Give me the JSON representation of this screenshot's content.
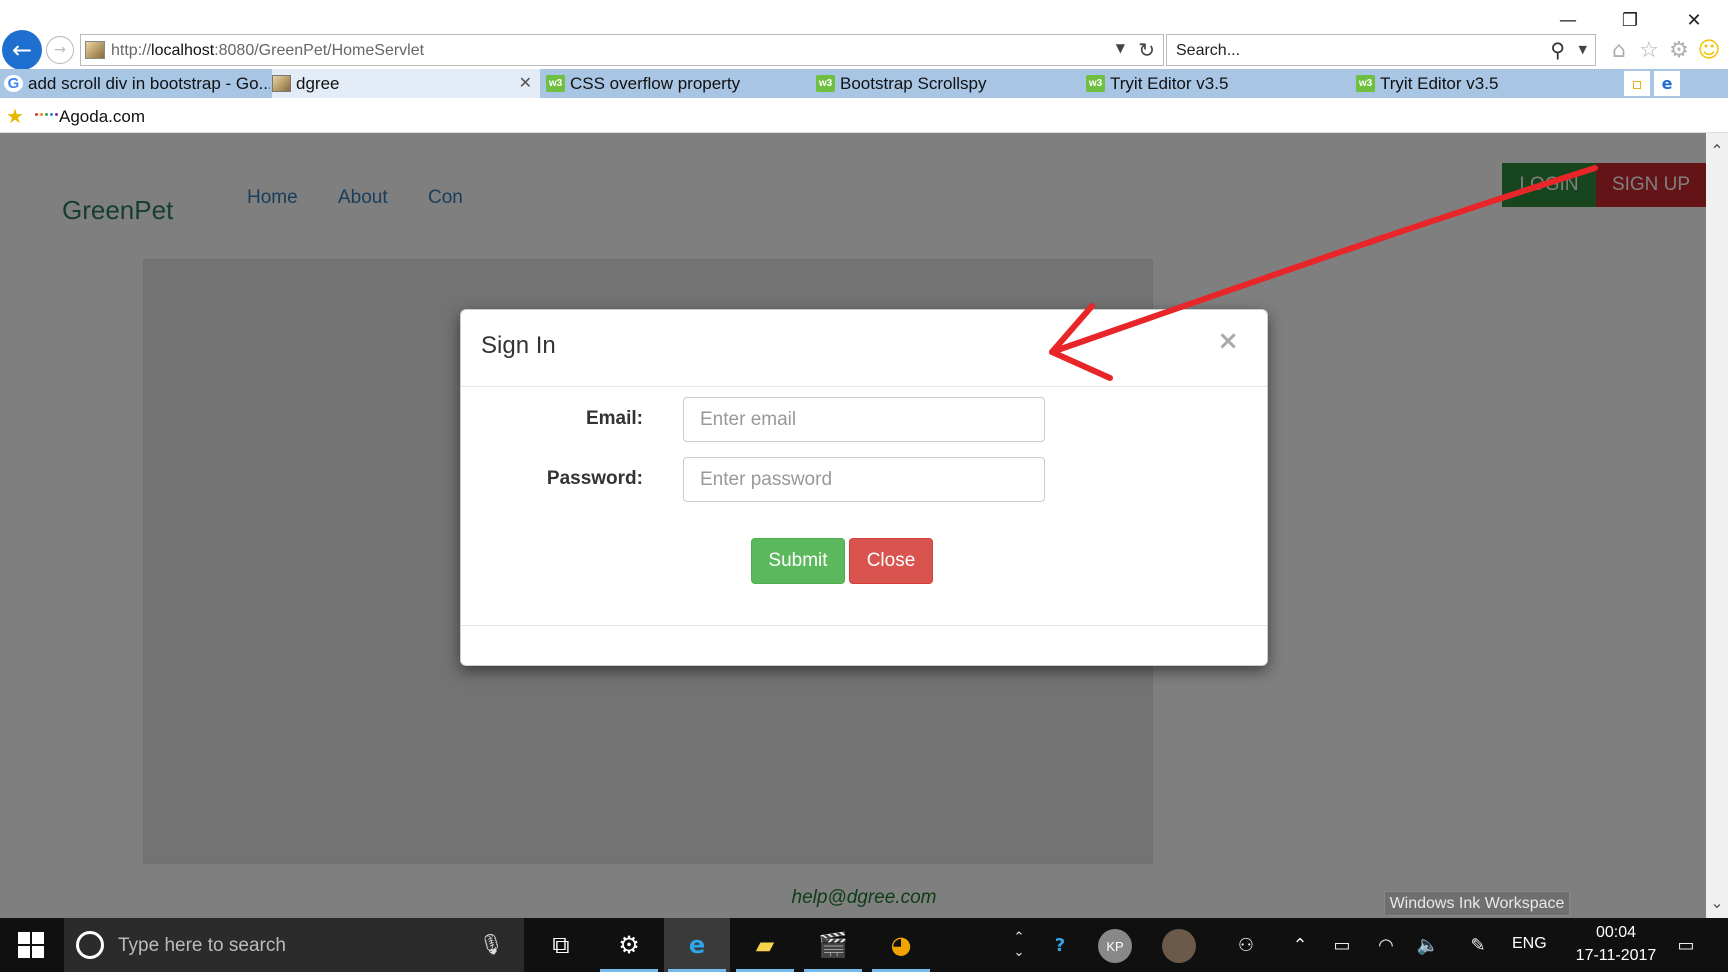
{
  "window": {
    "minimize_icon": "minimize-icon",
    "restore_icon": "restore-icon",
    "close_icon": "close-icon"
  },
  "address_bar": {
    "url_prefix": "http://",
    "url_host": "localhost",
    "url_rest": ":8080/GreenPet/HomeServlet"
  },
  "search_box": {
    "placeholder": "Search..."
  },
  "tabs": [
    {
      "label": "add scroll div in bootstrap - Go...",
      "icon": "google-icon"
    },
    {
      "label": "dgree",
      "icon": "page-icon",
      "active": true
    },
    {
      "label": "CSS overflow property",
      "icon": "w3schools-icon"
    },
    {
      "label": "Bootstrap Scrollspy",
      "icon": "w3schools-icon"
    },
    {
      "label": "Tryit Editor v3.5",
      "icon": "w3schools-icon"
    },
    {
      "label": "Tryit Editor v3.5",
      "icon": "w3schools-icon"
    }
  ],
  "favorites_bar": {
    "items": [
      {
        "label": "Agoda.com"
      }
    ]
  },
  "site": {
    "brand": "GreenPet",
    "nav": [
      "Home",
      "About",
      "Con"
    ],
    "login_label": "LOGIN",
    "signup_label": "SIGN UP",
    "footer_email": "help@dgree.com",
    "colors": {
      "login": "#2e8b3a",
      "signup": "#c8282d",
      "brand": "#2e7d5b"
    }
  },
  "modal": {
    "title": "Sign In",
    "close_glyph": "×",
    "email_label": "Email:",
    "email_placeholder": "Enter email",
    "password_label": "Password:",
    "password_placeholder": "Enter password",
    "submit_label": "Submit",
    "close_label": "Close"
  },
  "ink_tooltip": "Windows Ink Workspace",
  "taskbar": {
    "search_placeholder": "Type here to search",
    "avatar_initials": "KP",
    "language": "ENG",
    "time": "00:04",
    "date": "17-11-2017"
  }
}
